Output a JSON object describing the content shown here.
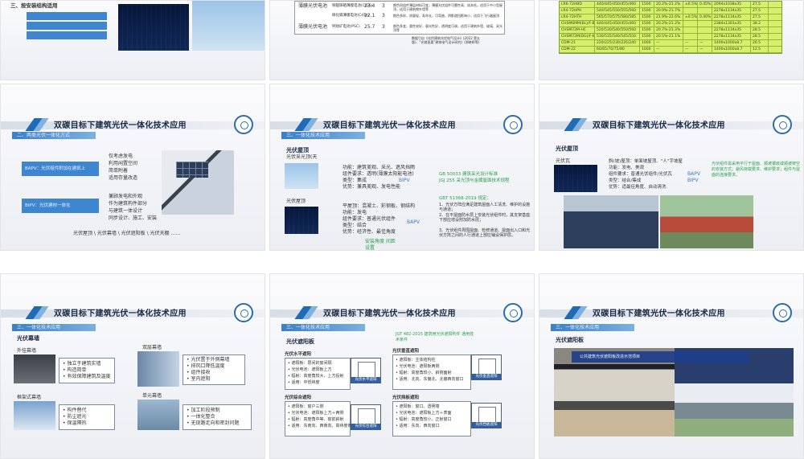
{
  "colors": {
    "accent": "#1f6bb5",
    "green_note": "#2aa14a",
    "table_bg": "#d8ef6a"
  },
  "common": {
    "slide_title": "双碳目标下建筑光伏一体化技术应用",
    "logo": "emblem-icon"
  },
  "slide1": {
    "heading": "三、按安装结构适用",
    "buttons": [
      "",
      "",
      ""
    ]
  },
  "slide2": {
    "rows": [
      {
        "a": "薄膜光伏电池",
        "b": "铜铟镓硒薄膜电池(CIGS)",
        "c": "23.4",
        "d": "3"
      },
      {
        "a": "",
        "b": "碲化镉薄膜电池(CdTe)",
        "c": "22.1",
        "d": "3"
      },
      {
        "a": "薄膜光伏电池",
        "b": "钙钛矿电池(PSC)",
        "c": "25.7",
        "d": "3"
      }
    ],
    "desc": [
      "颜色同组件薄层材料可变，薄膜光伏组件可靠性高、成本低，适用于中小型屋顶，适用于建筑物外墙等",
      "颜色多样，质量轻，寿命长，可弯曲，阴影遮挡影响小，适用于飞行器屋顶",
      "颜色多变，柔性较好，弱光性好，透明度可调，适用于建筑外墙、玻璃、采光顶等"
    ],
    "source": "数据引自《光伏建筑光伏电气设计》(2022 第五版)、\"光储直柔\"建筑电气设计研究》(郑晓晖等)"
  },
  "slide3": {
    "groups": [
      "平板光伏电池",
      "多晶硅",
      "薄膜光伏"
    ],
    "rows": [
      [
        "LR6-72HBD",
        "440/445/450/455/460",
        "1500",
        "20.2%-21.2%",
        "±0.5%",
        "0.45%",
        "2094x1038x35",
        "27.5"
      ],
      [
        "LR4-72HPH",
        "540/545/550/555/560",
        "1500",
        "20.9%-21.7%",
        "",
        "",
        "2278x1134x35",
        "27.5"
      ],
      [
        "LR4-72HTH",
        "565/570/575/580/585",
        "1500",
        "21.9%-22.6%",
        "±0.5%",
        "0.40%",
        "2278x1134x35",
        "27.5"
      ],
      [
        "CHSM6MM(BL)/F-BH",
        "440/445/450/455/460",
        "1500",
        "20.2%-21.2%",
        "",
        "",
        "2384x1303x35",
        "38.2"
      ],
      [
        "CHSM72M-HC",
        "520/530/540/550/560",
        "1500",
        "20.7%-21.3%",
        "",
        "",
        "2278x1134x35",
        "28.5"
      ],
      [
        "CHSM72M(DG)/F-BH",
        "530/535/540/545/550",
        "1500",
        "20.5%-21.1%",
        "",
        "",
        "2278x1134x35",
        "28.5"
      ],
      [
        "CDM-21",
        "220/225/230/235/240",
        "1000",
        "—",
        "—",
        "—",
        "1400x1000x8.7",
        "26.5"
      ],
      [
        "CDM-22",
        "60/65/70/75/80",
        "1000",
        "—",
        "—",
        "—",
        "1400x1000x8.7",
        "12.5"
      ]
    ],
    "notes": [
      "双面发电",
      "双玻组件",
      "轻质组件",
      "中空玻璃"
    ]
  },
  "slide4": {
    "section": "二、两类光伏一体化方式",
    "bapv": "BAPV：光伏组件附加在建筑上",
    "bipv": "BIPV：光伏建材一体化",
    "list1": [
      "仅考虑发电",
      "利用闲置空间",
      "简单附着",
      "适用存量改造"
    ],
    "list2": [
      "兼顾发电和外观",
      "作为建筑构件部分",
      "与建筑一体设计",
      "同步设计、施工、安装"
    ],
    "footer": "光伏屋顶 \\ 光伏幕墙 \\ 光伏遮阳板 \\ 光伏天棚 ……"
  },
  "slide5": {
    "section": "三、一体化技术应用",
    "heading": "光伏屋顶",
    "sub1": "光伏采光顶(天",
    "block1": [
      "功能：建筑美观、采光、遮风挡雨",
      "组件要求：透明(薄膜太阳能电池)",
      "类型：集成",
      "优势：兼具美观、发电性能"
    ],
    "tag1": "BIPV",
    "std1": "GB 50033 建筑采光设计标准",
    "std2": "JGJ 255 采光顶与金属屋面技术规程",
    "sub2": "光伏屋顶",
    "block2": [
      "平屋顶：混凝土、彩钢板、钢结构",
      "功能：发电",
      "组件要求：普通光伏组件",
      "类型：结合",
      "优势：经济性、最佳角度"
    ],
    "tag2": "BAPV",
    "std3": "GBT 51368-2019 规定：",
    "std3_items": [
      "1、光伏方阵应满足建筑屋面人工清洗、维护的设施与通道；",
      "2、在平屋面防水层上安装光伏组件时，其支架基座下部应增设附加防水层；",
      "3、光伏组件周围屋面、检修通道、屋面出入口和光伏方阵之间的人行通道上部应铺设保护层。"
    ],
    "note": "安装角度 间距设置"
  },
  "slide6": {
    "heading": "光伏屋顶",
    "sub": "光伏瓦",
    "block": [
      "斜(坡)屋顶：单面坡屋顶、\"人\"字坡屋",
      "功能：发电、美观",
      "组件要求：普通光伏组件/光伏瓦",
      "类型：结合/集成",
      "优势：适最佳角度、自动清洗"
    ],
    "tags": [
      "BAPV",
      "BIPV"
    ],
    "note": "光伏组件需采用平行于屋面、顺坡镶嵌或顺坡架空的安装方式；避风荷载要求、维护要求；组件与屋面的连接要求。"
  },
  "slide7": {
    "section": "三、一体化技术应用",
    "heading": "光伏幕墙",
    "blocks": [
      {
        "title": "外挂幕墙",
        "items": [
          "独立于建筑实墙",
          "构造简单",
          "有效保障建筑及温度"
        ]
      },
      {
        "title": "双层幕墙",
        "items": [
          "光伏置于外侧幕墙",
          "排风口降低温度",
          "组件接收",
          "室内遮阳"
        ]
      },
      {
        "title": "框架式幕墙",
        "items": [
          "构件替代",
          "防尘遮光",
          "保温隔热"
        ]
      },
      {
        "title": "单元幕墙",
        "items": [
          "加工阶段预制",
          "一体化整合",
          "无现路走向和密封问题"
        ]
      }
    ]
  },
  "slide8": {
    "section": "三、一体化技术应用",
    "heading": "光伏遮阳板",
    "std": "JGT 482-2015 建筑用光伏遮阳构件 通用技术条件",
    "cards": [
      {
        "title": "光伏水平遮阳",
        "items": [
          "遮阳板：层间的窗间隔",
          "光伏电池：遮阳板上方",
          "辐射：高度角较大、上方投射",
          "适用：中低纬度"
        ],
        "cap": "光伏水平遮阳"
      },
      {
        "title": "光伏垂直遮阳",
        "items": [
          "遮阳板：主体结构柱",
          "光伏电池：遮阳板两侧",
          "辐射：高度角较小、斜侧面射",
          "适用：北向、东偏北、北偏西向窗口"
        ],
        "cap": "光伏垂直遮阳"
      },
      {
        "title": "光伏综合遮阳",
        "items": [
          "遮阳板：窗户三侧",
          "光伏电池：遮阳板上方＋两侧",
          "辐射：高度角中等、窗前斜射",
          "适用：东南向、西南向，高纬度南向"
        ],
        "cap": "光伏综合遮阳"
      },
      {
        "title": "光伏挡板遮阳",
        "items": [
          "遮阳板：窗口、透明墙",
          "光伏电池：遮阳板上方＋表面",
          "辐射：高度角较小、正射窗口",
          "适用：东向、西向窗口"
        ],
        "cap": "光伏挡板遮阳"
      }
    ]
  },
  "slide9": {
    "section": "三、一体化技术应用",
    "heading": "光伏遮阳板",
    "banner": "公共建筑光伏遮阳板改造示范项目"
  }
}
